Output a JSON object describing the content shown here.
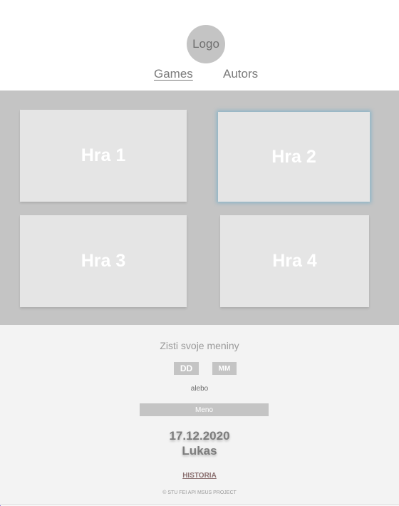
{
  "header": {
    "logo_text": "Logo",
    "nav": {
      "games": "Games",
      "autors": "Autors"
    }
  },
  "games": {
    "tiles": [
      {
        "label": "Hra 1"
      },
      {
        "label": "Hra 2"
      },
      {
        "label": "Hra 3"
      },
      {
        "label": "Hra 4"
      }
    ]
  },
  "nameday": {
    "title": "Zisti svoje meniny",
    "day_placeholder": "DD",
    "month_placeholder": "MM",
    "or_text": "alebo",
    "name_placeholder": "Meno",
    "result_date": "17.12.2020",
    "result_name": "Lukas",
    "history_link": "HISTORIA",
    "footer": "© STU FEI API MSUS PROJECT"
  },
  "colors": {
    "panel_gray": "#c4c4c4",
    "tile_gray": "#e5e5e5",
    "section_bg": "#f3f3f3",
    "selected_glow": "#78afc8"
  }
}
